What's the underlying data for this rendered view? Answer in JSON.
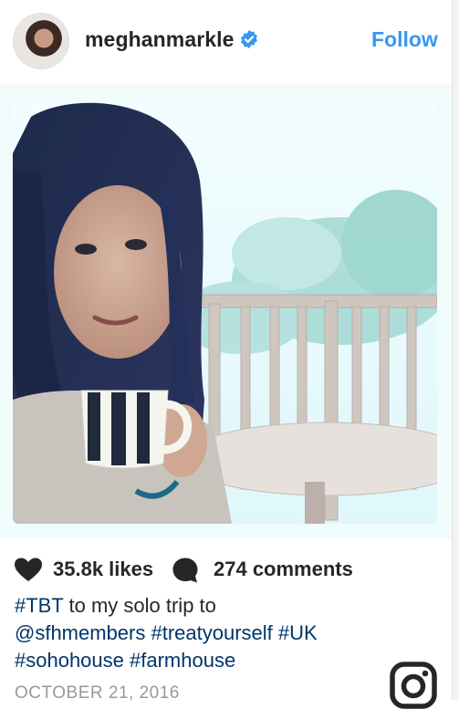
{
  "post": {
    "username": "meghanmarkle",
    "follow_label": "Follow",
    "likes_label": "35.8k likes",
    "comments_label": "274 comments",
    "caption": {
      "line1_tag": "#TBT",
      "line1_text": " to my solo trip to",
      "line2": [
        "@sfhmembers",
        "#treatyourself",
        "#UK"
      ],
      "line3": [
        "#sohohouse",
        "#farmhouse"
      ]
    },
    "date": "OCTOBER 21, 2016"
  },
  "colors": {
    "accent": "#3897f0",
    "hashtag": "#003569",
    "meta": "#999999"
  },
  "icons": [
    "verified-badge-icon",
    "heart-icon",
    "comment-icon",
    "instagram-logo-icon"
  ]
}
